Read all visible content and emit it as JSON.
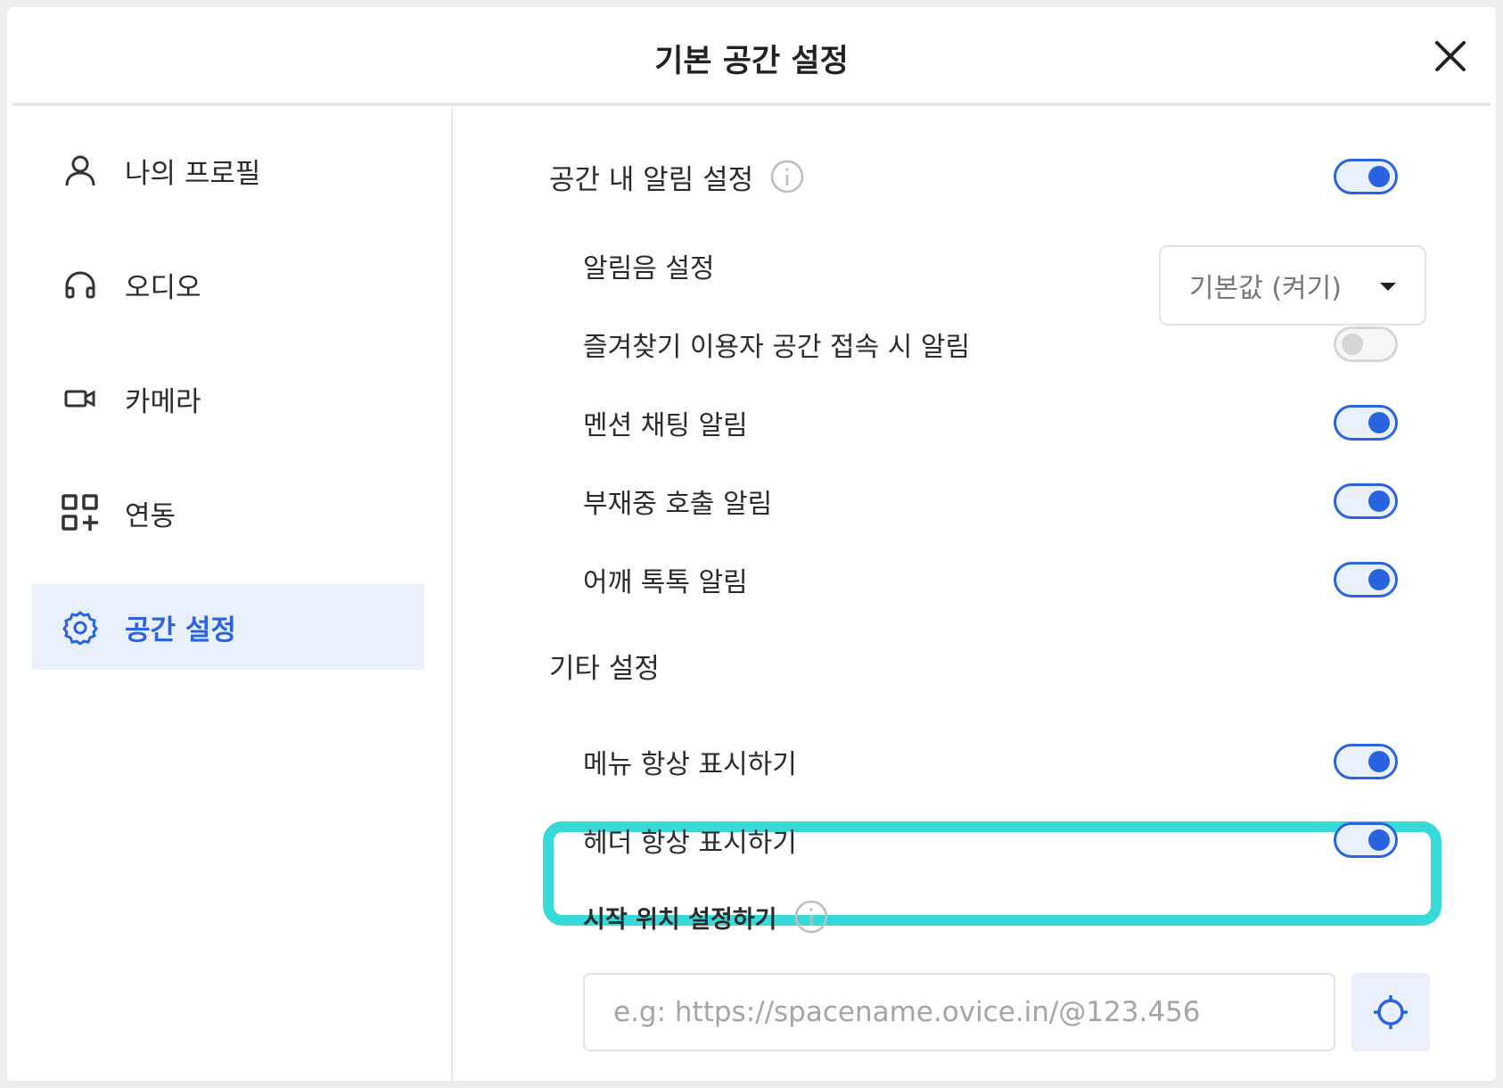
{
  "dialog": {
    "title": "기본 공간 설정"
  },
  "sidebar": {
    "items": [
      {
        "label": "나의 프로필",
        "icon": "user-icon"
      },
      {
        "label": "오디오",
        "icon": "headphones-icon"
      },
      {
        "label": "카메라",
        "icon": "video-camera-icon"
      },
      {
        "label": "연동",
        "icon": "apps-add-icon"
      },
      {
        "label": "공간 설정",
        "icon": "gear-icon",
        "active": true
      }
    ]
  },
  "notifications": {
    "label": "공간 내 알림 설정",
    "enabled": true,
    "sound": {
      "label": "알림음 설정",
      "value": "기본값 (켜기)"
    },
    "favorites": {
      "label": "즐겨찾기 이용자 공간 접속 시 알림",
      "enabled": false
    },
    "mention": {
      "label": "멘션 채팅 알림",
      "enabled": true
    },
    "away_call": {
      "label": "부재중 호출 알림",
      "enabled": true
    },
    "tap": {
      "label": "어깨 톡톡 알림",
      "enabled": true
    }
  },
  "other": {
    "label": "기타 설정",
    "menu_always": {
      "label": "메뉴 항상 표시하기",
      "enabled": true
    },
    "header_always": {
      "label": "헤더 항상 표시하기",
      "enabled": true
    },
    "start_position": {
      "label": "시작 위치 설정하기",
      "value": "",
      "placeholder": "e.g: https://spacename.ovice.in/@123.456"
    }
  },
  "colors": {
    "accent": "#2a63e0",
    "accent_bg": "#e9f0fc",
    "highlight": "#38d9d9"
  }
}
